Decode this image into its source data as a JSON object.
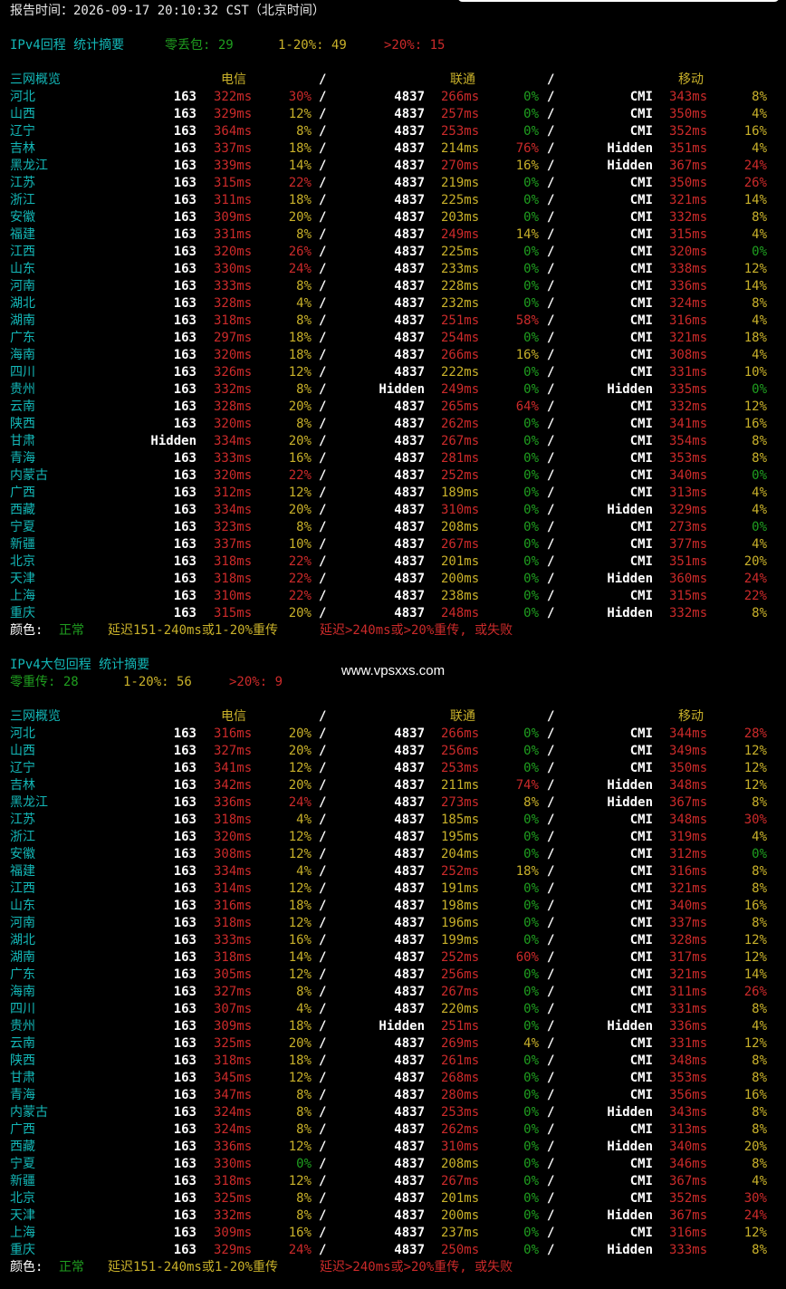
{
  "report_time": "报告时间：2026-09-17 20:10:32 CST（北京时间）",
  "watermark": "www.vpsxxs.com",
  "colors": {
    "cyan": "#13b7b7",
    "green": "#1f9e1f",
    "yellow": "#c9b12a",
    "red": "#cc2a2a",
    "white": "#ffffff",
    "background": "#000000"
  },
  "sections": [
    {
      "title": "IPv4回程 统计摘要",
      "summary": {
        "zero_label": "零丢包: 29",
        "mid_label": "1-20%: 49",
        "high_label": ">20%: 15"
      },
      "headers": {
        "overview": "三网概览",
        "telecom": "电信",
        "unicom": "联通",
        "mobile": "移动",
        "sep": "/"
      },
      "rows": [
        [
          "河北",
          "163",
          "322ms",
          "30%",
          "4837",
          "266ms",
          "0%",
          "CMI",
          "343ms",
          "8%"
        ],
        [
          "山西",
          "163",
          "329ms",
          "12%",
          "4837",
          "257ms",
          "0%",
          "CMI",
          "350ms",
          "4%"
        ],
        [
          "辽宁",
          "163",
          "364ms",
          "8%",
          "4837",
          "253ms",
          "0%",
          "CMI",
          "352ms",
          "16%"
        ],
        [
          "吉林",
          "163",
          "337ms",
          "18%",
          "4837",
          "214ms",
          "76%",
          "Hidden",
          "351ms",
          "4%"
        ],
        [
          "黑龙江",
          "163",
          "339ms",
          "14%",
          "4837",
          "270ms",
          "16%",
          "Hidden",
          "367ms",
          "24%"
        ],
        [
          "江苏",
          "163",
          "315ms",
          "22%",
          "4837",
          "219ms",
          "0%",
          "CMI",
          "350ms",
          "26%"
        ],
        [
          "浙江",
          "163",
          "311ms",
          "18%",
          "4837",
          "225ms",
          "0%",
          "CMI",
          "321ms",
          "14%"
        ],
        [
          "安徽",
          "163",
          "309ms",
          "20%",
          "4837",
          "203ms",
          "0%",
          "CMI",
          "332ms",
          "8%"
        ],
        [
          "福建",
          "163",
          "331ms",
          "8%",
          "4837",
          "249ms",
          "14%",
          "CMI",
          "315ms",
          "4%"
        ],
        [
          "江西",
          "163",
          "320ms",
          "26%",
          "4837",
          "225ms",
          "0%",
          "CMI",
          "320ms",
          "0%"
        ],
        [
          "山东",
          "163",
          "330ms",
          "24%",
          "4837",
          "233ms",
          "0%",
          "CMI",
          "338ms",
          "12%"
        ],
        [
          "河南",
          "163",
          "333ms",
          "8%",
          "4837",
          "228ms",
          "0%",
          "CMI",
          "336ms",
          "14%"
        ],
        [
          "湖北",
          "163",
          "328ms",
          "4%",
          "4837",
          "232ms",
          "0%",
          "CMI",
          "324ms",
          "8%"
        ],
        [
          "湖南",
          "163",
          "318ms",
          "8%",
          "4837",
          "251ms",
          "58%",
          "CMI",
          "316ms",
          "4%"
        ],
        [
          "广东",
          "163",
          "297ms",
          "18%",
          "4837",
          "254ms",
          "0%",
          "CMI",
          "321ms",
          "18%"
        ],
        [
          "海南",
          "163",
          "320ms",
          "18%",
          "4837",
          "266ms",
          "16%",
          "CMI",
          "308ms",
          "4%"
        ],
        [
          "四川",
          "163",
          "326ms",
          "12%",
          "4837",
          "222ms",
          "0%",
          "CMI",
          "331ms",
          "10%"
        ],
        [
          "贵州",
          "163",
          "332ms",
          "8%",
          "Hidden",
          "249ms",
          "0%",
          "Hidden",
          "335ms",
          "0%"
        ],
        [
          "云南",
          "163",
          "328ms",
          "20%",
          "4837",
          "265ms",
          "64%",
          "CMI",
          "332ms",
          "12%"
        ],
        [
          "陕西",
          "163",
          "320ms",
          "8%",
          "4837",
          "262ms",
          "0%",
          "CMI",
          "341ms",
          "16%"
        ],
        [
          "甘肃",
          "Hidden",
          "334ms",
          "20%",
          "4837",
          "267ms",
          "0%",
          "CMI",
          "354ms",
          "8%"
        ],
        [
          "青海",
          "163",
          "333ms",
          "16%",
          "4837",
          "281ms",
          "0%",
          "CMI",
          "353ms",
          "8%"
        ],
        [
          "内蒙古",
          "163",
          "320ms",
          "22%",
          "4837",
          "252ms",
          "0%",
          "CMI",
          "340ms",
          "0%"
        ],
        [
          "广西",
          "163",
          "312ms",
          "12%",
          "4837",
          "189ms",
          "0%",
          "CMI",
          "313ms",
          "4%"
        ],
        [
          "西藏",
          "163",
          "334ms",
          "20%",
          "4837",
          "310ms",
          "0%",
          "Hidden",
          "329ms",
          "4%"
        ],
        [
          "宁夏",
          "163",
          "323ms",
          "8%",
          "4837",
          "208ms",
          "0%",
          "CMI",
          "273ms",
          "0%"
        ],
        [
          "新疆",
          "163",
          "337ms",
          "10%",
          "4837",
          "267ms",
          "0%",
          "CMI",
          "377ms",
          "4%"
        ],
        [
          "北京",
          "163",
          "318ms",
          "22%",
          "4837",
          "201ms",
          "0%",
          "CMI",
          "351ms",
          "20%"
        ],
        [
          "天津",
          "163",
          "318ms",
          "22%",
          "4837",
          "200ms",
          "0%",
          "Hidden",
          "360ms",
          "24%"
        ],
        [
          "上海",
          "163",
          "310ms",
          "22%",
          "4837",
          "238ms",
          "0%",
          "CMI",
          "315ms",
          "22%"
        ],
        [
          "重庆",
          "163",
          "315ms",
          "20%",
          "4837",
          "248ms",
          "0%",
          "Hidden",
          "332ms",
          "8%"
        ]
      ],
      "legend": {
        "label": "颜色: ",
        "normal": "正常",
        "mid": "延迟151-240ms或1-20%重传",
        "bad": "延迟>240ms或>20%重传, 或失败"
      }
    },
    {
      "title": "IPv4大包回程 统计摘要",
      "summary": {
        "zero_label": "零重传: 28",
        "mid_label": "1-20%: 56",
        "high_label": ">20%: 9"
      },
      "headers": {
        "overview": "三网概览",
        "telecom": "电信",
        "unicom": "联通",
        "mobile": "移动",
        "sep": "/"
      },
      "rows": [
        [
          "河北",
          "163",
          "316ms",
          "20%",
          "4837",
          "266ms",
          "0%",
          "CMI",
          "344ms",
          "28%"
        ],
        [
          "山西",
          "163",
          "327ms",
          "20%",
          "4837",
          "256ms",
          "0%",
          "CMI",
          "349ms",
          "12%"
        ],
        [
          "辽宁",
          "163",
          "341ms",
          "12%",
          "4837",
          "253ms",
          "0%",
          "CMI",
          "350ms",
          "12%"
        ],
        [
          "吉林",
          "163",
          "342ms",
          "20%",
          "4837",
          "211ms",
          "74%",
          "Hidden",
          "348ms",
          "12%"
        ],
        [
          "黑龙江",
          "163",
          "336ms",
          "24%",
          "4837",
          "273ms",
          "8%",
          "Hidden",
          "367ms",
          "8%"
        ],
        [
          "江苏",
          "163",
          "318ms",
          "4%",
          "4837",
          "185ms",
          "0%",
          "CMI",
          "348ms",
          "30%"
        ],
        [
          "浙江",
          "163",
          "320ms",
          "12%",
          "4837",
          "195ms",
          "0%",
          "CMI",
          "319ms",
          "4%"
        ],
        [
          "安徽",
          "163",
          "308ms",
          "12%",
          "4837",
          "204ms",
          "0%",
          "CMI",
          "312ms",
          "0%"
        ],
        [
          "福建",
          "163",
          "334ms",
          "4%",
          "4837",
          "252ms",
          "18%",
          "CMI",
          "316ms",
          "8%"
        ],
        [
          "江西",
          "163",
          "314ms",
          "12%",
          "4837",
          "191ms",
          "0%",
          "CMI",
          "321ms",
          "8%"
        ],
        [
          "山东",
          "163",
          "316ms",
          "18%",
          "4837",
          "198ms",
          "0%",
          "CMI",
          "340ms",
          "16%"
        ],
        [
          "河南",
          "163",
          "318ms",
          "12%",
          "4837",
          "196ms",
          "0%",
          "CMI",
          "337ms",
          "8%"
        ],
        [
          "湖北",
          "163",
          "333ms",
          "16%",
          "4837",
          "199ms",
          "0%",
          "CMI",
          "328ms",
          "12%"
        ],
        [
          "湖南",
          "163",
          "318ms",
          "14%",
          "4837",
          "252ms",
          "60%",
          "CMI",
          "317ms",
          "12%"
        ],
        [
          "广东",
          "163",
          "305ms",
          "12%",
          "4837",
          "256ms",
          "0%",
          "CMI",
          "321ms",
          "14%"
        ],
        [
          "海南",
          "163",
          "327ms",
          "8%",
          "4837",
          "267ms",
          "0%",
          "CMI",
          "311ms",
          "26%"
        ],
        [
          "四川",
          "163",
          "307ms",
          "4%",
          "4837",
          "220ms",
          "0%",
          "CMI",
          "331ms",
          "8%"
        ],
        [
          "贵州",
          "163",
          "309ms",
          "18%",
          "Hidden",
          "251ms",
          "0%",
          "Hidden",
          "336ms",
          "4%"
        ],
        [
          "云南",
          "163",
          "325ms",
          "20%",
          "4837",
          "269ms",
          "4%",
          "CMI",
          "331ms",
          "12%"
        ],
        [
          "陕西",
          "163",
          "318ms",
          "18%",
          "4837",
          "261ms",
          "0%",
          "CMI",
          "348ms",
          "8%"
        ],
        [
          "甘肃",
          "163",
          "345ms",
          "12%",
          "4837",
          "268ms",
          "0%",
          "CMI",
          "353ms",
          "8%"
        ],
        [
          "青海",
          "163",
          "347ms",
          "8%",
          "4837",
          "280ms",
          "0%",
          "CMI",
          "356ms",
          "16%"
        ],
        [
          "内蒙古",
          "163",
          "324ms",
          "8%",
          "4837",
          "253ms",
          "0%",
          "Hidden",
          "343ms",
          "8%"
        ],
        [
          "广西",
          "163",
          "324ms",
          "8%",
          "4837",
          "262ms",
          "0%",
          "CMI",
          "313ms",
          "8%"
        ],
        [
          "西藏",
          "163",
          "336ms",
          "12%",
          "4837",
          "310ms",
          "0%",
          "Hidden",
          "340ms",
          "20%"
        ],
        [
          "宁夏",
          "163",
          "330ms",
          "0%",
          "4837",
          "208ms",
          "0%",
          "CMI",
          "346ms",
          "8%"
        ],
        [
          "新疆",
          "163",
          "318ms",
          "12%",
          "4837",
          "267ms",
          "0%",
          "CMI",
          "367ms",
          "4%"
        ],
        [
          "北京",
          "163",
          "325ms",
          "8%",
          "4837",
          "201ms",
          "0%",
          "CMI",
          "352ms",
          "30%"
        ],
        [
          "天津",
          "163",
          "332ms",
          "8%",
          "4837",
          "200ms",
          "0%",
          "Hidden",
          "367ms",
          "24%"
        ],
        [
          "上海",
          "163",
          "309ms",
          "16%",
          "4837",
          "237ms",
          "0%",
          "CMI",
          "316ms",
          "12%"
        ],
        [
          "重庆",
          "163",
          "329ms",
          "24%",
          "4837",
          "250ms",
          "0%",
          "Hidden",
          "333ms",
          "8%"
        ]
      ],
      "legend": {
        "label": "颜色: ",
        "normal": "正常",
        "mid": "延迟151-240ms或1-20%重传",
        "bad": "延迟>240ms或>20%重传, 或失败"
      }
    }
  ]
}
